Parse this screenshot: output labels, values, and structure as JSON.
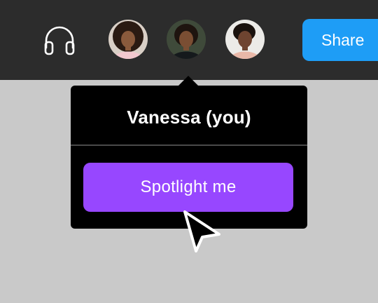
{
  "toolbar": {
    "share_label": "Share",
    "icons": {
      "audio": "headphones-icon"
    },
    "avatars": [
      {
        "name": "participant-1"
      },
      {
        "name": "participant-2"
      },
      {
        "name": "participant-3"
      }
    ]
  },
  "popover": {
    "title": "Vanessa (you)",
    "action_label": "Spotlight me"
  },
  "colors": {
    "toolbar_bg": "#2c2c2c",
    "canvas_bg": "#c9c9c9",
    "share_blue": "#1e9df6",
    "spotlight_purple": "#9747ff",
    "popover_bg": "#000000"
  }
}
